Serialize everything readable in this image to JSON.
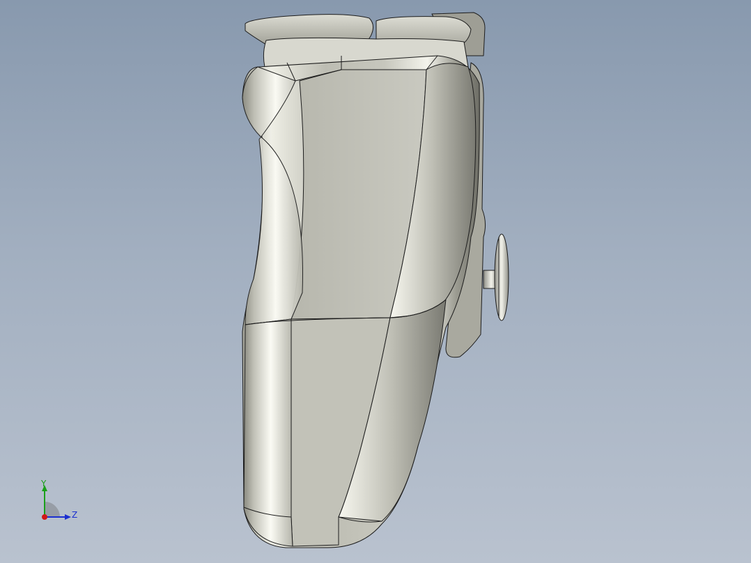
{
  "viewport": {
    "background_top": "#8899ae",
    "background_bottom": "#b9c2cf"
  },
  "model": {
    "name": "game-controller-grip",
    "body_color": "#c4c4bb",
    "edge_color": "#1c1c1c"
  },
  "triad": {
    "y_label": "Y",
    "z_label": "Z",
    "y_color": "#1aa01a",
    "z_color": "#1b2fd0",
    "x_color": "#d01818"
  }
}
